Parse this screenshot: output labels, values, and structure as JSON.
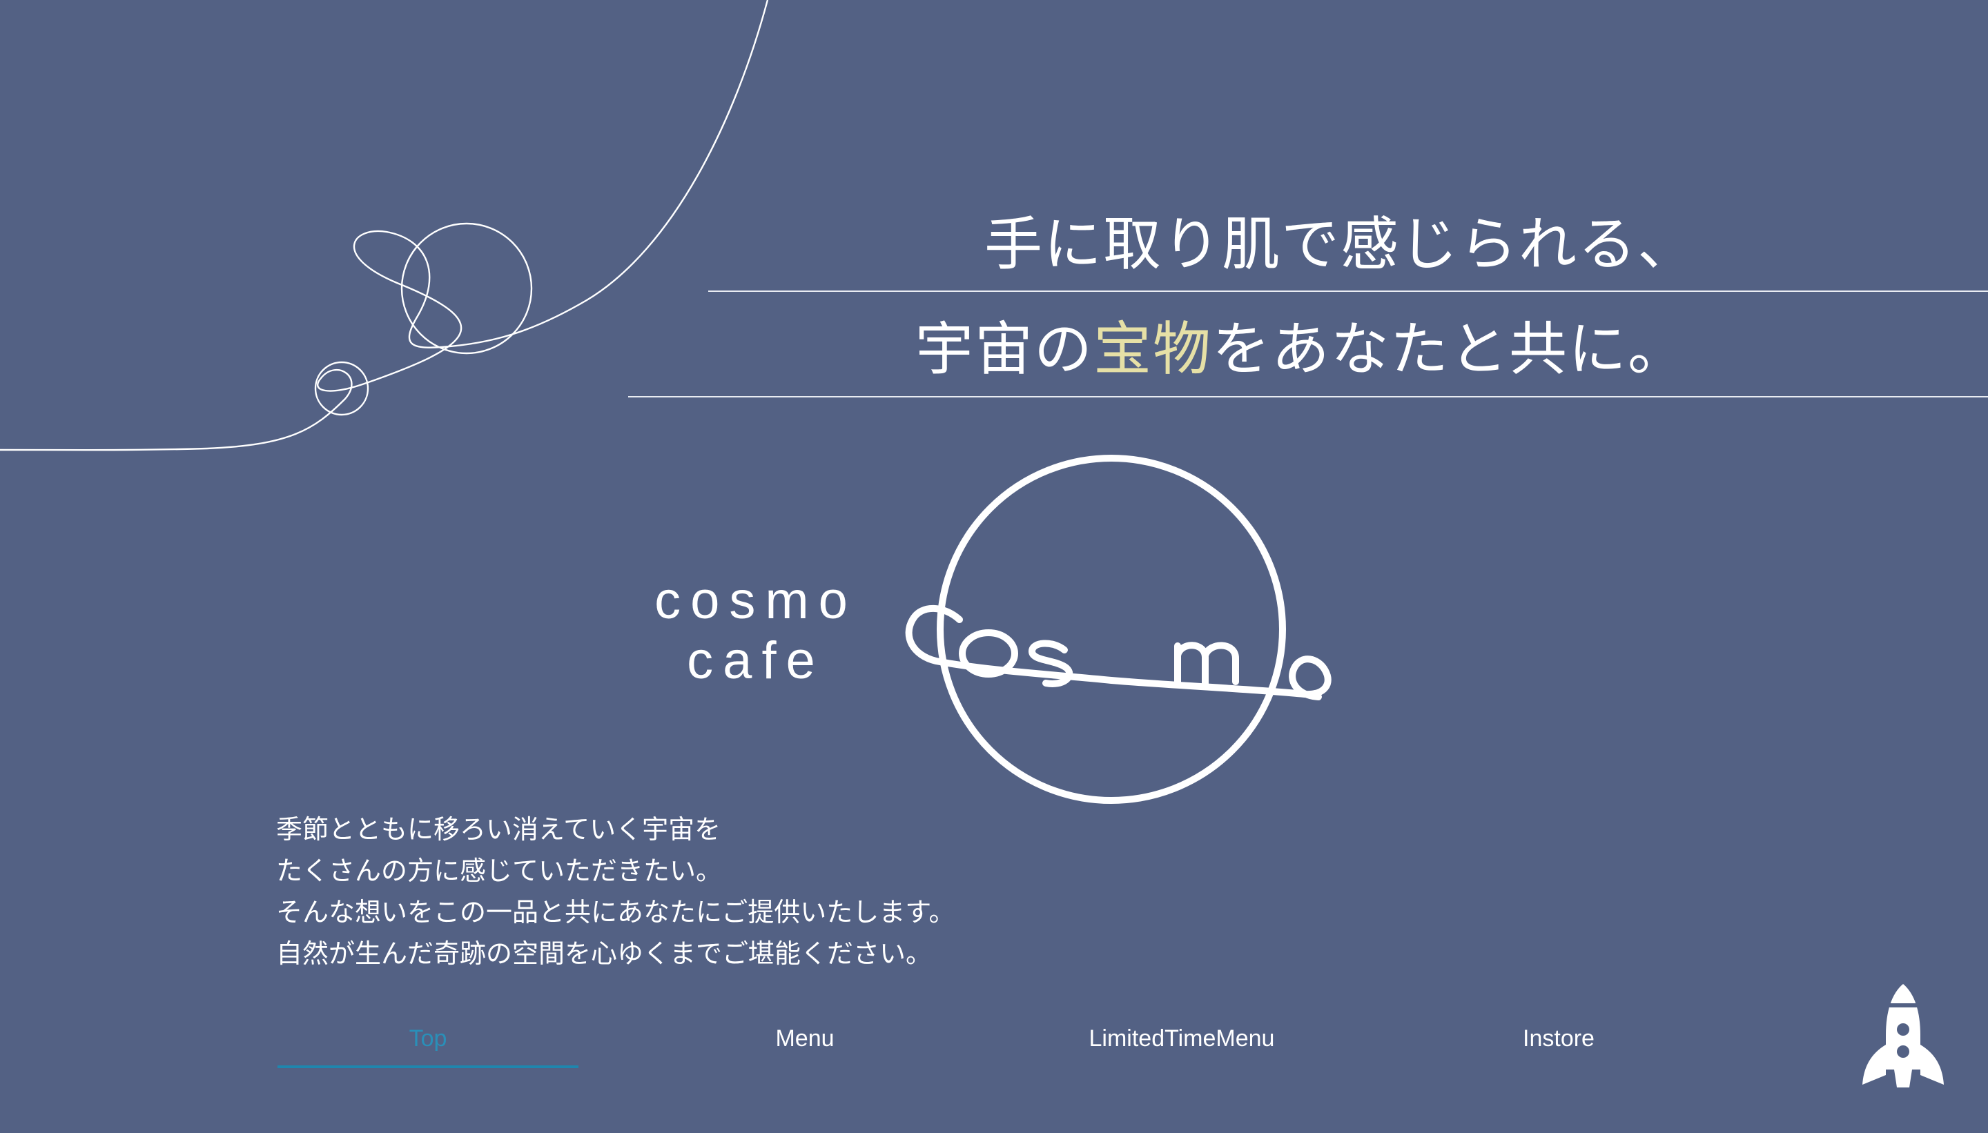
{
  "hero": {
    "line1": "手に取り肌で感じられる、",
    "line2_prefix": "宇宙の",
    "line2_highlight": "宝物",
    "line2_suffix": "をあなたと共に。",
    "highlight_color": "#e6e0a6"
  },
  "brand": {
    "name_line1": "cosmo",
    "name_line2": "cafe",
    "logo_text": "cosmo"
  },
  "intro": {
    "lines": [
      "季節とともに移ろい消えていく宇宙を",
      "たくさんの方に感じていただきたい。",
      "そんな想いをこの一品と共にあなたにご提供いたします。",
      "自然が生んだ奇跡の空間を心ゆくまでご堪能ください。"
    ]
  },
  "nav": {
    "items": [
      {
        "label": "Top",
        "active": true
      },
      {
        "label": "Menu",
        "active": false
      },
      {
        "label": "LimitedTimeMenu",
        "active": false
      },
      {
        "label": "Instore",
        "active": false
      }
    ],
    "active_color": "#1f86ae"
  },
  "icons": {
    "scroll_top": "rocket-icon"
  },
  "colors": {
    "background": "#536184",
    "foreground": "#ffffff"
  }
}
